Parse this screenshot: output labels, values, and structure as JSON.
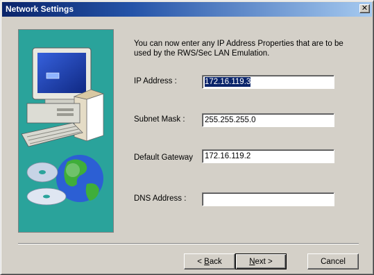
{
  "window": {
    "title": "Network Settings"
  },
  "description": "You can now enter any IP Address Properties that are to be used by the RWS/Sec LAN Emulation.",
  "fields": {
    "ip_address": {
      "label": "IP Address :",
      "value": "172.16.119.3"
    },
    "subnet_mask": {
      "label": "Subnet Mask :",
      "value": "255.255.255.0"
    },
    "default_gateway": {
      "label": "Default Gateway",
      "value": "172.16.119.2"
    },
    "dns_address": {
      "label": "DNS Address :",
      "value": ""
    }
  },
  "buttons": {
    "back": {
      "prefix": "< ",
      "accel": "B",
      "rest": "ack"
    },
    "next": {
      "accel": "N",
      "rest": "ext >"
    },
    "cancel": {
      "label": "Cancel"
    }
  },
  "illustration": {
    "background_color": "#2aa39b",
    "icons": [
      "computer-monitor-icon",
      "software-box-icon",
      "keyboard-icon",
      "cd-discs-icon",
      "globe-icon"
    ]
  },
  "colors": {
    "titlebar_start": "#0a246a",
    "titlebar_end": "#a6caf0",
    "dialog_face": "#d4d0c8",
    "selection": "#0a246a"
  }
}
